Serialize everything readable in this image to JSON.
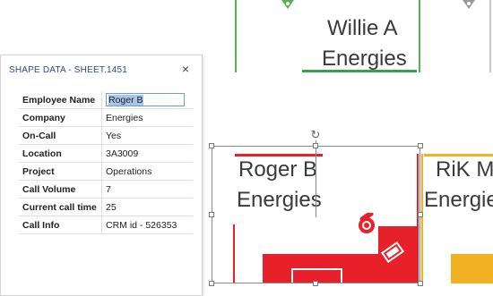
{
  "shapes": {
    "top_center": {
      "line1": "Willie A",
      "line2": "Energies"
    },
    "selected": {
      "line1": "Roger B",
      "line2": "Energies"
    },
    "right": {
      "line1": "RiK M",
      "line2": "Energies"
    }
  },
  "panel": {
    "title": "SHAPE DATA - SHEET.1451",
    "close_glyph": "×",
    "rows": [
      {
        "key": "Employee Name",
        "value": "Roger B"
      },
      {
        "key": "Company",
        "value": "Energies"
      },
      {
        "key": "On-Call",
        "value": "Yes"
      },
      {
        "key": "Location",
        "value": "3A3009"
      },
      {
        "key": "Project",
        "value": "Operations"
      },
      {
        "key": "Call Volume",
        "value": "7"
      },
      {
        "key": "Current call time",
        "value": "25"
      },
      {
        "key": "Call Info",
        "value": "CRM id - 526353"
      }
    ]
  },
  "icons": {
    "rotate": "rotate-handle-icon",
    "rotate_glyph": "↻"
  },
  "colors": {
    "on_call_green": "#58b05c",
    "selected_red": "#e8202a",
    "warning_yellow": "#f2b120",
    "panel_title": "#2e4d7e"
  }
}
